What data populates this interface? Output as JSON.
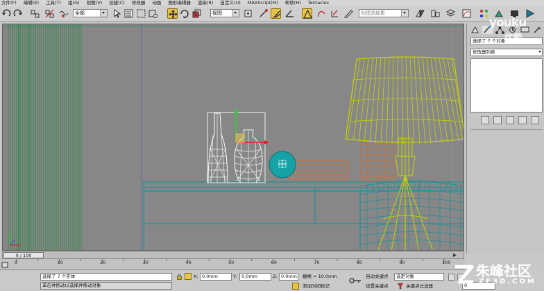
{
  "menu": [
    "文件(F)",
    "编辑(E)",
    "工具(T)",
    "组(G)",
    "视图(V)",
    "创建(C)",
    "修改器",
    "动画",
    "图形编辑器",
    "渲染(R)",
    "自定义(U)",
    "MAXScript(M)",
    "帮助(H)",
    "Tentacles"
  ],
  "toolbar": {
    "selection_filter": "全部",
    "reference_coord": "视图",
    "named_selection_placeholder": "创建选择集"
  },
  "panel": {
    "selection_info": "选择了 7 个对象",
    "modifier_list": "修改器列表"
  },
  "timeline": {
    "frame_display": "0 / 100",
    "ticks": [
      "0",
      "10",
      "20",
      "30",
      "40",
      "50",
      "60",
      "70",
      "80",
      "90",
      "100"
    ]
  },
  "status": {
    "selected_count": "选择了 7 个实体",
    "prompt": "单击并拖动以选择并移动对象",
    "x_label": "X:",
    "x_value": "0.0mm",
    "y_label": "Y:",
    "y_value": "0.0mm",
    "z_label": "Z:",
    "z_value": "0.0mm",
    "grid_label": "栅格 = 10.0mm",
    "add_time_tag": "添加时间标记",
    "auto_key": "自动关键点",
    "set_key": "设置关键点",
    "selected_object": "选定对象",
    "key_filters": "关键点过滤器",
    "frame_value": "0"
  },
  "watermarks": {
    "youku": "youku",
    "youku_cn": "优酷",
    "zhufeng_cn": "朱峰社区",
    "zhufeng_url": "ZF3D.COM"
  },
  "colors": {
    "viewport_bg": "#878787",
    "wire_yellow": "#c8d400",
    "wire_teal": "#1f8f9a",
    "wire_orange": "#c8703a",
    "wire_white": "#f0f0f0",
    "curtain_green": "#1c8a3a",
    "sphere_teal": "#16a3a8"
  }
}
